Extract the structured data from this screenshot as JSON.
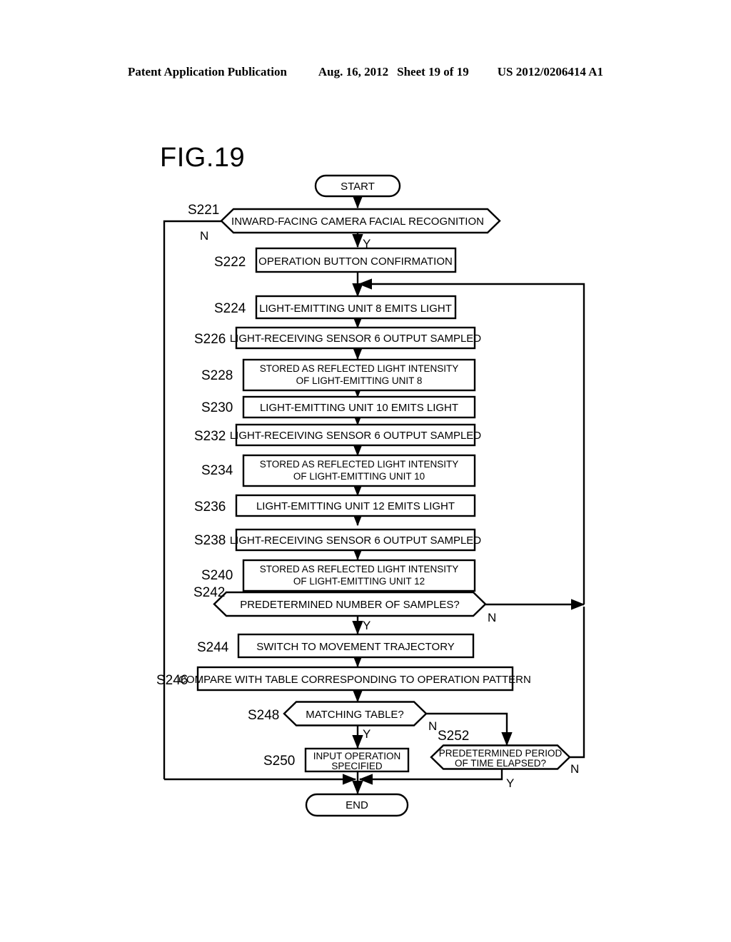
{
  "header": {
    "publication": "Patent Application Publication",
    "date": "Aug. 16, 2012",
    "sheet": "Sheet 19 of 19",
    "number": "US 2012/0206414 A1"
  },
  "figure": {
    "title": "FIG.19"
  },
  "flowchart": {
    "terminals": {
      "start": "START",
      "end": "END"
    },
    "branch_labels": {
      "yes": "Y",
      "no": "N"
    },
    "steps": [
      {
        "id": "S221",
        "type": "decision",
        "lines": [
          "INWARD-FACING CAMERA FACIAL RECOGNITION"
        ]
      },
      {
        "id": "S222",
        "type": "process",
        "lines": [
          "OPERATION BUTTON CONFIRMATION"
        ]
      },
      {
        "id": "S224",
        "type": "process",
        "lines": [
          "LIGHT-EMITTING UNIT 8 EMITS LIGHT"
        ]
      },
      {
        "id": "S226",
        "type": "process",
        "lines": [
          "LIGHT-RECEIVING SENSOR 6 OUTPUT SAMPLED"
        ]
      },
      {
        "id": "S228",
        "type": "process",
        "lines": [
          "STORED AS REFLECTED LIGHT INTENSITY",
          "OF LIGHT-EMITTING UNIT 8"
        ]
      },
      {
        "id": "S230",
        "type": "process",
        "lines": [
          "LIGHT-EMITTING UNIT 10 EMITS LIGHT"
        ]
      },
      {
        "id": "S232",
        "type": "process",
        "lines": [
          "LIGHT-RECEIVING SENSOR 6 OUTPUT SAMPLED"
        ]
      },
      {
        "id": "S234",
        "type": "process",
        "lines": [
          "STORED AS REFLECTED LIGHT INTENSITY",
          "OF LIGHT-EMITTING UNIT 10"
        ]
      },
      {
        "id": "S236",
        "type": "process",
        "lines": [
          "LIGHT-EMITTING UNIT 12 EMITS LIGHT"
        ]
      },
      {
        "id": "S238",
        "type": "process",
        "lines": [
          "LIGHT-RECEIVING SENSOR 6 OUTPUT SAMPLED"
        ]
      },
      {
        "id": "S240",
        "type": "process",
        "lines": [
          "STORED AS REFLECTED LIGHT INTENSITY",
          "OF LIGHT-EMITTING UNIT 12"
        ]
      },
      {
        "id": "S242",
        "type": "decision",
        "lines": [
          "PREDETERMINED NUMBER OF SAMPLES?"
        ]
      },
      {
        "id": "S244",
        "type": "process",
        "lines": [
          "SWITCH TO MOVEMENT TRAJECTORY"
        ]
      },
      {
        "id": "S246",
        "type": "process",
        "lines": [
          "COMPARE WITH TABLE CORRESPONDING TO OPERATION PATTERN"
        ]
      },
      {
        "id": "S248",
        "type": "decision",
        "lines": [
          "MATCHING TABLE?"
        ]
      },
      {
        "id": "S250",
        "type": "process",
        "lines": [
          "INPUT OPERATION",
          "SPECIFIED"
        ]
      },
      {
        "id": "S252",
        "type": "decision",
        "lines": [
          "PREDETERMINED PERIOD",
          "OF TIME ELAPSED?"
        ]
      }
    ]
  }
}
